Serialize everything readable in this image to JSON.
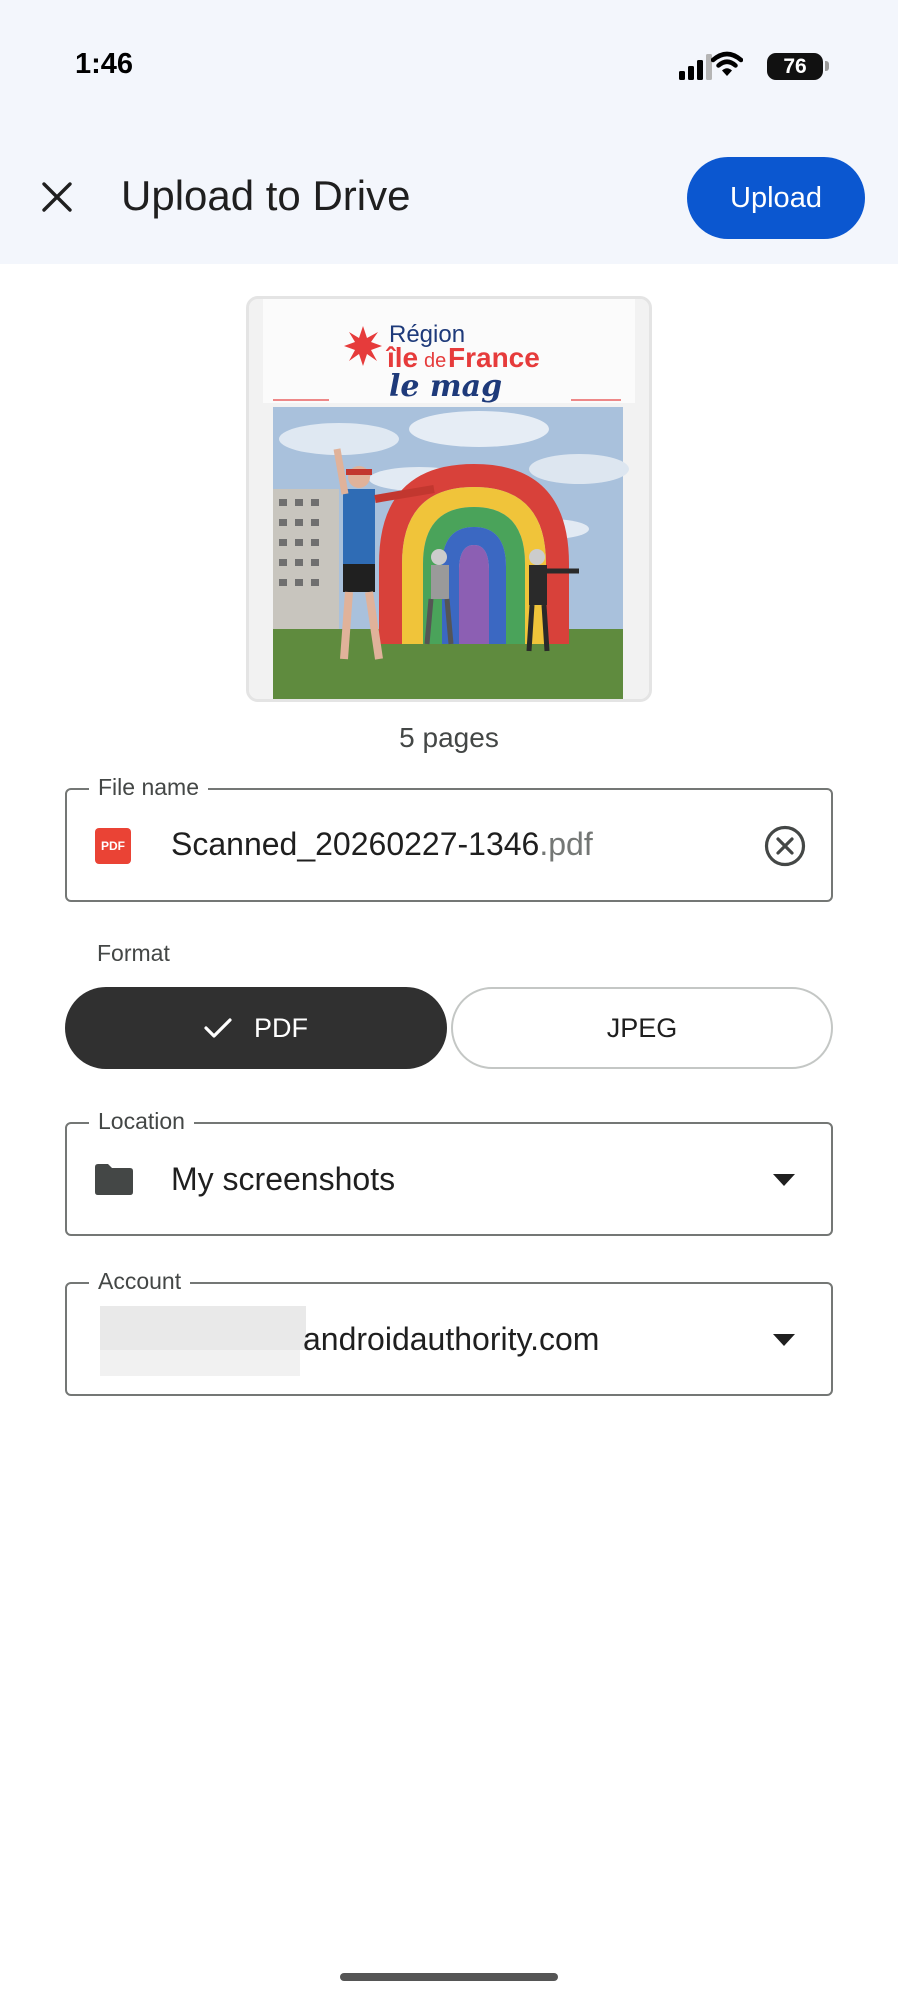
{
  "status_bar": {
    "time": "1:46",
    "battery": "76"
  },
  "header": {
    "title": "Upload to Drive",
    "upload_label": "Upload"
  },
  "preview": {
    "region_line": "Région",
    "ile_text": "île",
    "de_text": "de",
    "france_text": "France",
    "mag_text": "le mag",
    "page_count": "5 pages"
  },
  "file_name": {
    "legend": "File name",
    "base": "Scanned_20260227-1346",
    "extension": ".pdf",
    "file_icon_text": "PDF"
  },
  "format": {
    "label": "Format",
    "options": [
      {
        "label": "PDF",
        "selected": true
      },
      {
        "label": "JPEG",
        "selected": false
      }
    ]
  },
  "location": {
    "legend": "Location",
    "value": "My screenshots"
  },
  "account": {
    "legend": "Account",
    "value_visible": "androidauthority.com"
  },
  "colors": {
    "accent": "#0b57d0",
    "header_bg": "#f3f6fc",
    "selected_segment": "#303030",
    "pdf_icon": "#ea4335"
  }
}
